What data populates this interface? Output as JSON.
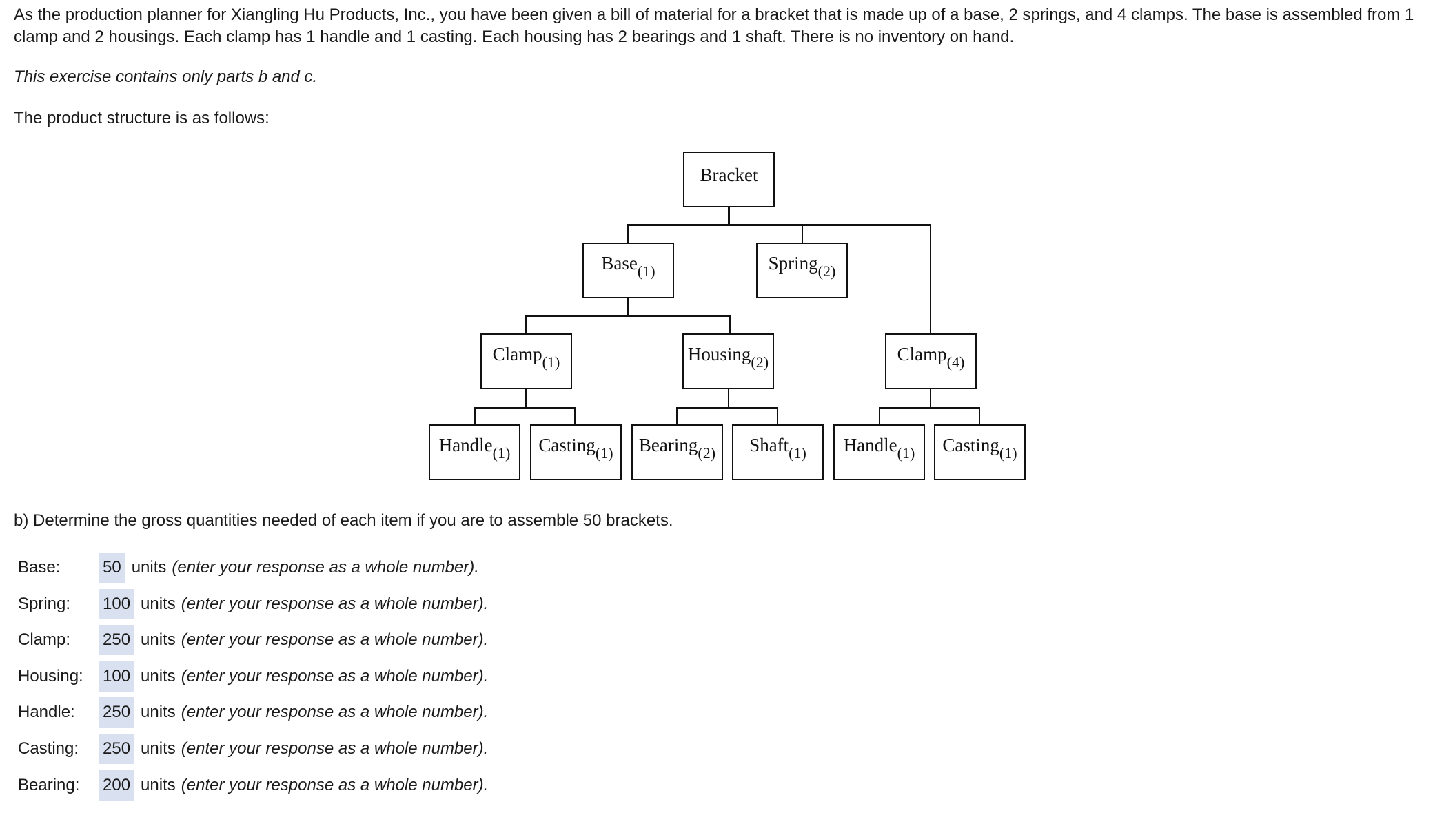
{
  "intro": "As the production planner for Xiangling Hu Products, Inc., you have been given a bill of material for a bracket that is made up of a base, 2 springs, and 4 clamps. The base is assembled from 1 clamp and 2 housings. Each clamp has 1 handle and 1 casting. Each housing has 2 bearings and 1 shaft. There is no inventory on hand.",
  "note": "This exercise contains only parts b and c.",
  "structure_label": "The product structure is as follows:",
  "diagram": {
    "root": {
      "name": "Bracket"
    },
    "level2": [
      {
        "name": "Base",
        "qty": "(1)"
      },
      {
        "name": "Spring",
        "qty": "(2)"
      }
    ],
    "level3": [
      {
        "name": "Clamp",
        "qty": "(1)"
      },
      {
        "name": "Housing",
        "qty": "(2)"
      },
      {
        "name": "Clamp",
        "qty": "(4)"
      }
    ],
    "level4": [
      {
        "name": "Handle",
        "qty": "(1)"
      },
      {
        "name": "Casting",
        "qty": "(1)"
      },
      {
        "name": "Bearing",
        "qty": "(2)"
      },
      {
        "name": "Shaft",
        "qty": "(1)"
      },
      {
        "name": "Handle",
        "qty": "(1)"
      },
      {
        "name": "Casting",
        "qty": "(1)"
      }
    ]
  },
  "part_b": {
    "prompt": "b) Determine the gross quantities needed of each item if you are to assemble 50 brackets.",
    "units_label": "units",
    "hint": "(enter your response as a whole number).",
    "answers": [
      {
        "label": "Base:",
        "value": "50"
      },
      {
        "label": "Spring:",
        "value": "100"
      },
      {
        "label": "Clamp:",
        "value": "250"
      },
      {
        "label": "Housing:",
        "value": "100"
      },
      {
        "label": "Handle:",
        "value": "250"
      },
      {
        "label": "Casting:",
        "value": "250"
      },
      {
        "label": "Bearing:",
        "value": "200"
      }
    ]
  },
  "colors": {
    "answer_bg": "#d9e1f0",
    "text": "#1a1a1a"
  }
}
